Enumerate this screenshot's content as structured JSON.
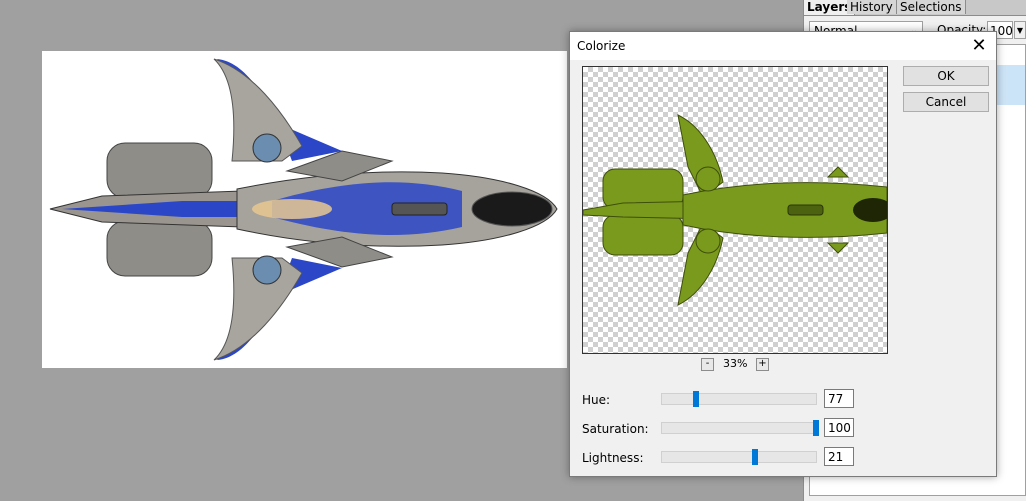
{
  "panel": {
    "tabs": [
      "Layers",
      "History",
      "Selections"
    ],
    "blend_mode": "Normal",
    "opacity_label": "Opacity:",
    "opacity_value": "100"
  },
  "dialog": {
    "title": "Colorize",
    "ok_label": "OK",
    "cancel_label": "Cancel",
    "zoom_minus": "-",
    "zoom_value": "33%",
    "zoom_plus": "+",
    "sliders": [
      {
        "label": "Hue:",
        "value": "77",
        "fraction": 0.22
      },
      {
        "label": "Saturation:",
        "value": "100",
        "fraction": 1.0
      },
      {
        "label": "Lightness:",
        "value": "21",
        "fraction": 0.605
      }
    ]
  },
  "colors": {
    "accent": "#0078d7",
    "ship_blue": "#2b47c8",
    "ship_hull": "#9c9a94",
    "preview_green": "#7a9a1e"
  },
  "icons": {
    "close": "close-icon",
    "dropdown": "chevron-down-icon"
  }
}
